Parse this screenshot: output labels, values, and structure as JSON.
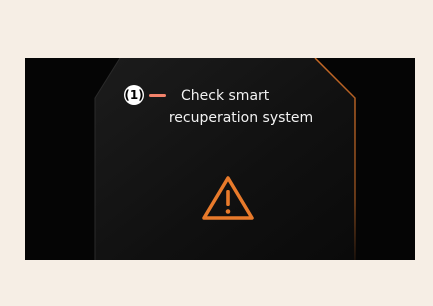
{
  "callout": {
    "number": "(1)"
  },
  "message": {
    "line1": "Check smart",
    "line2": "recuperation system"
  },
  "icons": {
    "warning": "warning-triangle-icon"
  },
  "colors": {
    "background": "#f6eee5",
    "screen": "#050505",
    "accent_orange": "#e87a2b",
    "callout_line": "#f3836b"
  }
}
